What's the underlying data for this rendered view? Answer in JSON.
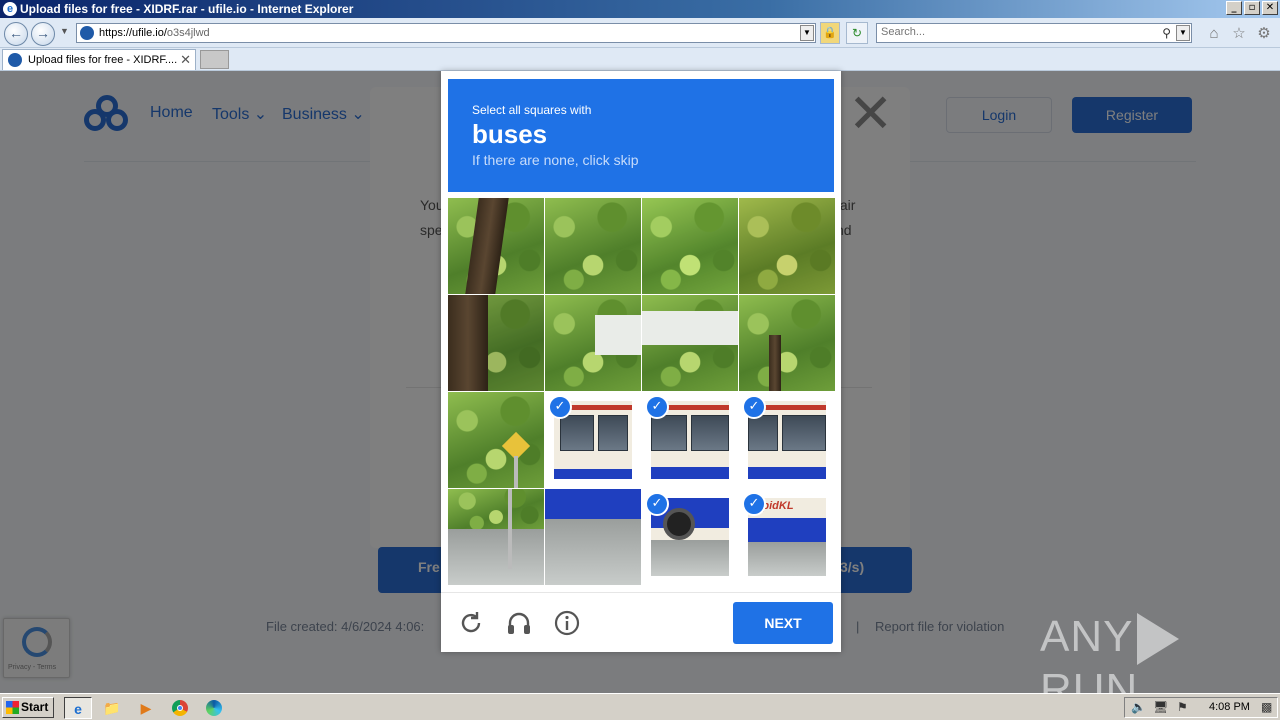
{
  "window": {
    "title": "Upload files for free - XIDRF.rar - ufile.io - Internet Explorer",
    "minimize": "_",
    "restore": "▫",
    "close": "✕"
  },
  "browser": {
    "url_host": "https://ufile.io/",
    "url_path": "o3s4jlwd",
    "search_placeholder": "Search...",
    "tab_label": "Upload files for free - XIDRF....",
    "tab_close": "✕"
  },
  "site": {
    "nav": [
      "Home",
      "Tools ⌄",
      "Business ⌄"
    ],
    "login": "Login",
    "register": "Register",
    "modal_text_left": [
      "You",
      "spe"
    ],
    "modal_text_right": [
      "fair",
      "nd"
    ],
    "download_left": "Fre",
    "download_right": "3/s)",
    "file_created": "File created: 4/6/2024 4:06:",
    "separator": "|",
    "report": "Report file for violation",
    "recaptcha_badge": "Privacy - Terms"
  },
  "captcha": {
    "subtitle": "Select all squares with",
    "target": "buses",
    "hint": "If there are none, click skip",
    "next_label": "NEXT",
    "tiles": [
      {
        "scene": "tree-trunk",
        "selected": false
      },
      {
        "scene": "foliage",
        "selected": false
      },
      {
        "scene": "foliage",
        "selected": false
      },
      {
        "scene": "foliage",
        "selected": false
      },
      {
        "scene": "tree-trunk",
        "selected": false
      },
      {
        "scene": "building",
        "selected": false
      },
      {
        "scene": "building",
        "selected": false
      },
      {
        "scene": "foliage",
        "selected": false
      },
      {
        "scene": "sign",
        "selected": false
      },
      {
        "scene": "bus-front",
        "selected": true
      },
      {
        "scene": "bus-mid",
        "selected": true
      },
      {
        "scene": "bus-mid",
        "selected": true
      },
      {
        "scene": "sign-road",
        "selected": false
      },
      {
        "scene": "bus-bottom",
        "selected": false
      },
      {
        "scene": "bus-wheel",
        "selected": true
      },
      {
        "scene": "bus-logo",
        "selected": true
      }
    ],
    "colors": {
      "accent": "#1f72e6",
      "header_text": "#ffffff"
    }
  },
  "watermark": {
    "left": "ANY",
    "right": "RUN"
  },
  "taskbar": {
    "start": "Start",
    "clock": "4:08 PM"
  },
  "icons": [
    "ie-icon",
    "back-icon",
    "forward-icon",
    "lock-icon",
    "refresh-icon",
    "search-icon",
    "home-icon",
    "favorites-icon",
    "settings-icon",
    "reload-challenge-icon",
    "audio-icon",
    "info-icon"
  ]
}
